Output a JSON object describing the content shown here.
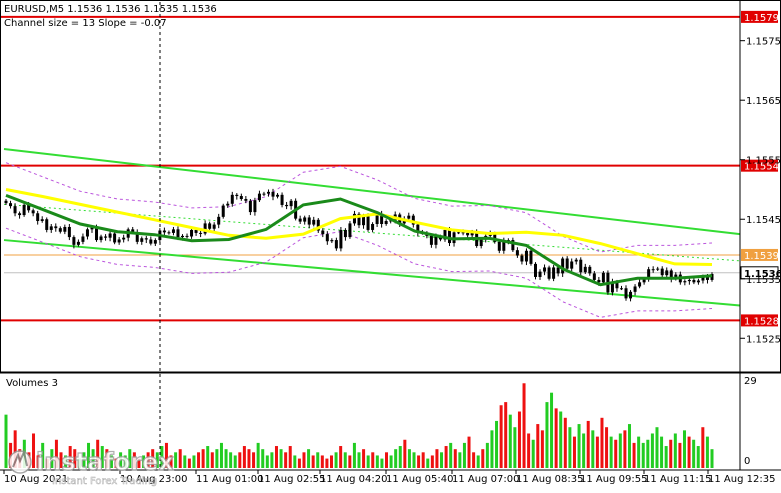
{
  "header": {
    "symbol_line": "EURUSD,M5  1.1536 1.1536 1.1535 1.1536",
    "indicator_line": "Channel size = 13 Slope = -0.07"
  },
  "volume_panel": {
    "label": "Volumes 3",
    "max_tick": "29",
    "zero_tick": "0"
  },
  "watermark": {
    "brand": "instaforex",
    "tagline": "Instant Forex Trading"
  },
  "chart_data": {
    "type": "candlestick",
    "symbol": "EURUSD",
    "timeframe": "M5",
    "ohlc_header": {
      "open": 1.1536,
      "high": 1.1536,
      "low": 1.1535,
      "close": 1.1536
    },
    "ylim": [
      1.15195,
      1.15815
    ],
    "y_ticks": [
      1.1525,
      1.1535,
      1.1545,
      1.1555,
      1.1565,
      1.1575
    ],
    "x_tick_labels": [
      "10 Aug 2021",
      "10 Aug 23:00",
      "11 Aug 01:00",
      "11 Aug 02:55",
      "11 Aug 04:20",
      "11 Aug 05:40",
      "11 Aug 07:00",
      "11 Aug 08:35",
      "11 Aug 09:55",
      "11 Aug 11:15",
      "11 Aug 12:35"
    ],
    "grid": false,
    "horizontal_levels": [
      {
        "label": "1.1579",
        "value": 1.1579,
        "color": "#e00000",
        "kind": "resistance"
      },
      {
        "label": "1.1554",
        "value": 1.1554,
        "color": "#e00000",
        "kind": "resistance"
      },
      {
        "label": "1.1539",
        "value": 1.1539,
        "color": "#f0a040",
        "kind": "moving-average-marker"
      },
      {
        "label": "1.1536",
        "value": 1.1536,
        "color": "#ffffff",
        "kind": "current-price"
      },
      {
        "label": "1.1528",
        "value": 1.1528,
        "color": "#e00000",
        "kind": "support"
      }
    ],
    "channel_lines": [
      {
        "name": "upper",
        "start": 1.15568,
        "end": 1.15425,
        "color": "#33dd33"
      },
      {
        "name": "middle",
        "start": 1.15475,
        "end": 1.1538,
        "color": "#33dd33",
        "style": "dotted"
      },
      {
        "name": "lower",
        "start": 1.15415,
        "end": 1.15305,
        "color": "#33dd33"
      }
    ],
    "closes": [
      1.15477,
      1.15472,
      1.1546,
      1.15457,
      1.15474,
      1.15465,
      1.1546,
      1.15447,
      1.1545,
      1.15432,
      1.15438,
      1.15435,
      1.15429,
      1.15437,
      1.1542,
      1.15407,
      1.15412,
      1.15421,
      1.15433,
      1.15436,
      1.15415,
      1.15421,
      1.15419,
      1.15426,
      1.15411,
      1.15416,
      1.15419,
      1.15433,
      1.15428,
      1.15412,
      1.15418,
      1.15416,
      1.15409,
      1.15415,
      1.15431,
      1.15428,
      1.15427,
      1.15433,
      1.1542,
      1.15422,
      1.15421,
      1.15432,
      1.15427,
      1.15426,
      1.15443,
      1.15434,
      1.15441,
      1.15454,
      1.15473,
      1.15476,
      1.15491,
      1.15489,
      1.15484,
      1.15481,
      1.15462,
      1.15482,
      1.15493,
      1.15493,
      1.15496,
      1.15488,
      1.15491,
      1.15474,
      1.15472,
      1.15481,
      1.15451,
      1.15446,
      1.15453,
      1.15441,
      1.15449,
      1.15431,
      1.15425,
      1.15413,
      1.15415,
      1.15401,
      1.15432,
      1.1542,
      1.15443,
      1.15459,
      1.1544,
      1.15455,
      1.15432,
      1.15442,
      1.15459,
      1.15442,
      1.15447,
      1.15448,
      1.15458,
      1.15443,
      1.15451,
      1.15456,
      1.15441,
      1.15427,
      1.15427,
      1.15422,
      1.15407,
      1.15421,
      1.15416,
      1.15432,
      1.1541,
      1.15428,
      1.15428,
      1.15427,
      1.15423,
      1.15428,
      1.15405,
      1.15416,
      1.15422,
      1.15426,
      1.15412,
      1.15397,
      1.15414,
      1.15415,
      1.15398,
      1.15389,
      1.15379,
      1.15397,
      1.15375,
      1.15353,
      1.15362,
      1.15369,
      1.1535,
      1.15369,
      1.15359,
      1.15384,
      1.15367,
      1.15379,
      1.15382,
      1.15361,
      1.1537,
      1.15359,
      1.15348,
      1.15344,
      1.1536,
      1.15327,
      1.15345,
      1.15334,
      1.15334,
      1.15317,
      1.15328,
      1.15337,
      1.15344,
      1.1535,
      1.15366,
      1.15366,
      1.15367,
      1.15356,
      1.15364,
      1.1535,
      1.15357,
      1.15344,
      1.15346,
      1.15348,
      1.15344,
      1.15347,
      1.15353,
      1.15348,
      1.15358
    ],
    "ma_series": [
      {
        "name": "slow-ma",
        "color": "#ffff00",
        "start": 1.155,
        "points": [
          1.155,
          1.15488,
          1.15475,
          1.15462,
          1.15449,
          1.15436,
          1.15423,
          1.15418,
          1.15425,
          1.15451,
          1.15459,
          1.15445,
          1.15432,
          1.15426,
          1.15428,
          1.15423,
          1.15409,
          1.15392,
          1.15375,
          1.15374
        ]
      },
      {
        "name": "fast-ma",
        "color": "#1a8a1a",
        "start": 1.1549,
        "points": [
          1.1549,
          1.15466,
          1.15442,
          1.15429,
          1.15424,
          1.15414,
          1.15416,
          1.15433,
          1.15474,
          1.15484,
          1.15461,
          1.1543,
          1.15417,
          1.15418,
          1.15406,
          1.15366,
          1.1534,
          1.15351,
          1.15351,
          1.15355
        ]
      }
    ],
    "volumes": [
      17,
      8,
      12,
      6,
      9,
      5,
      11,
      4,
      8,
      3,
      6,
      9,
      5,
      4,
      7,
      6,
      3,
      5,
      8,
      6,
      9,
      7,
      6,
      4,
      3,
      5,
      4,
      6,
      5,
      3,
      4,
      5,
      6,
      5,
      7,
      8,
      4,
      5,
      6,
      4,
      3,
      4,
      5,
      6,
      7,
      5,
      6,
      8,
      6,
      5,
      4,
      5,
      7,
      6,
      5,
      8,
      6,
      4,
      5,
      7,
      6,
      5,
      7,
      4,
      3,
      5,
      6,
      4,
      5,
      4,
      3,
      4,
      5,
      7,
      5,
      4,
      8,
      5,
      6,
      4,
      5,
      4,
      3,
      5,
      4,
      6,
      7,
      9,
      6,
      5,
      4,
      5,
      3,
      4,
      6,
      5,
      7,
      8,
      6,
      5,
      8,
      10,
      5,
      4,
      6,
      8,
      12,
      15,
      20,
      21,
      17,
      13,
      18,
      27,
      11,
      9,
      14,
      12,
      21,
      24,
      19,
      18,
      16,
      13,
      10,
      14,
      11,
      15,
      12,
      10,
      16,
      13,
      10,
      9,
      11,
      12,
      14,
      8,
      10,
      8,
      9,
      11,
      13,
      10,
      7,
      9,
      11,
      8,
      12,
      10,
      9,
      7,
      13,
      10,
      6
    ],
    "volume_axis": {
      "max": 29,
      "min": 0
    }
  },
  "colors": {
    "up_volume": "#22cc22",
    "down_volume": "#ee1111",
    "candle": "#000000",
    "envelope": "#bb55dd"
  }
}
